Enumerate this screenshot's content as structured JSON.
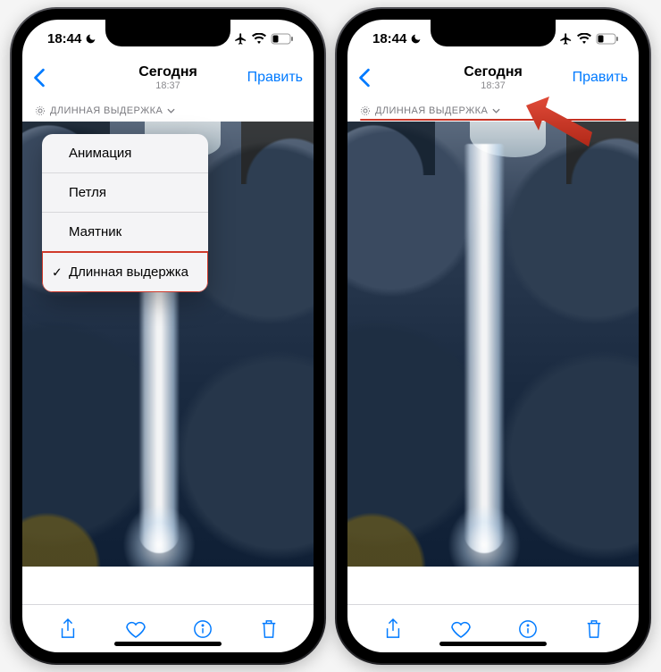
{
  "status": {
    "time": "18:44",
    "moon_icon": "moon-icon"
  },
  "nav": {
    "title": "Сегодня",
    "subtitle": "18:37",
    "edit": "Править"
  },
  "effect": {
    "label": "ДЛИННАЯ ВЫДЕРЖКА"
  },
  "dropdown": {
    "items": [
      {
        "label": "Анимация",
        "selected": false
      },
      {
        "label": "Петля",
        "selected": false
      },
      {
        "label": "Маятник",
        "selected": false
      },
      {
        "label": "Длинная выдержка",
        "selected": true
      }
    ]
  },
  "toolbar": {
    "share": "share-icon",
    "favorite": "heart-icon",
    "info": "info-icon",
    "delete": "trash-icon"
  }
}
